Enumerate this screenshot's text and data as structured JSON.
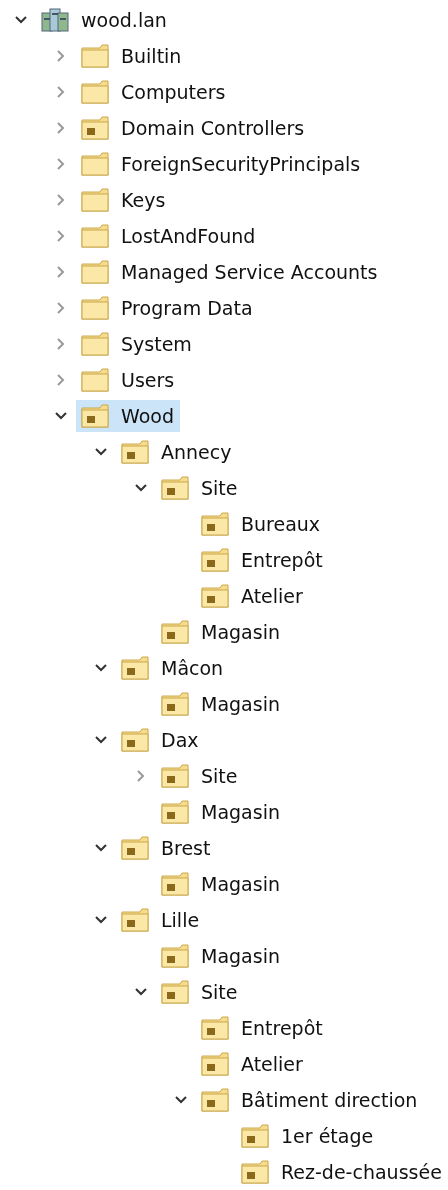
{
  "tree": [
    {
      "label": "wood.lan",
      "kind": "domain",
      "expandable": true,
      "expanded": true,
      "selected": false,
      "children": [
        {
          "label": "Builtin",
          "kind": "container",
          "expandable": true,
          "expanded": false,
          "selected": false
        },
        {
          "label": "Computers",
          "kind": "container",
          "expandable": true,
          "expanded": false,
          "selected": false
        },
        {
          "label": "Domain Controllers",
          "kind": "ou",
          "expandable": true,
          "expanded": false,
          "selected": false
        },
        {
          "label": "ForeignSecurityPrincipals",
          "kind": "container",
          "expandable": true,
          "expanded": false,
          "selected": false
        },
        {
          "label": "Keys",
          "kind": "container",
          "expandable": true,
          "expanded": false,
          "selected": false
        },
        {
          "label": "LostAndFound",
          "kind": "container",
          "expandable": true,
          "expanded": false,
          "selected": false
        },
        {
          "label": "Managed Service Accounts",
          "kind": "container",
          "expandable": true,
          "expanded": false,
          "selected": false
        },
        {
          "label": "Program Data",
          "kind": "container",
          "expandable": true,
          "expanded": false,
          "selected": false
        },
        {
          "label": "System",
          "kind": "container",
          "expandable": true,
          "expanded": false,
          "selected": false
        },
        {
          "label": "Users",
          "kind": "container",
          "expandable": true,
          "expanded": false,
          "selected": false
        },
        {
          "label": "Wood",
          "kind": "ou",
          "expandable": true,
          "expanded": true,
          "selected": true,
          "children": [
            {
              "label": "Annecy",
              "kind": "ou",
              "expandable": true,
              "expanded": true,
              "selected": false,
              "children": [
                {
                  "label": "Site",
                  "kind": "ou",
                  "expandable": true,
                  "expanded": true,
                  "selected": false,
                  "children": [
                    {
                      "label": "Bureaux",
                      "kind": "ou",
                      "expandable": false,
                      "selected": false
                    },
                    {
                      "label": "Entrepôt",
                      "kind": "ou",
                      "expandable": false,
                      "selected": false
                    },
                    {
                      "label": "Atelier",
                      "kind": "ou",
                      "expandable": false,
                      "selected": false
                    }
                  ]
                },
                {
                  "label": "Magasin",
                  "kind": "ou",
                  "expandable": false,
                  "selected": false
                }
              ]
            },
            {
              "label": "Mâcon",
              "kind": "ou",
              "expandable": true,
              "expanded": true,
              "selected": false,
              "children": [
                {
                  "label": "Magasin",
                  "kind": "ou",
                  "expandable": false,
                  "selected": false
                }
              ]
            },
            {
              "label": "Dax",
              "kind": "ou",
              "expandable": true,
              "expanded": true,
              "selected": false,
              "children": [
                {
                  "label": "Site",
                  "kind": "ou",
                  "expandable": true,
                  "expanded": false,
                  "selected": false
                },
                {
                  "label": "Magasin",
                  "kind": "ou",
                  "expandable": false,
                  "selected": false
                }
              ]
            },
            {
              "label": "Brest",
              "kind": "ou",
              "expandable": true,
              "expanded": true,
              "selected": false,
              "children": [
                {
                  "label": "Magasin",
                  "kind": "ou",
                  "expandable": false,
                  "selected": false
                }
              ]
            },
            {
              "label": "Lille",
              "kind": "ou",
              "expandable": true,
              "expanded": true,
              "selected": false,
              "children": [
                {
                  "label": "Magasin",
                  "kind": "ou",
                  "expandable": false,
                  "selected": false
                },
                {
                  "label": "Site",
                  "kind": "ou",
                  "expandable": true,
                  "expanded": true,
                  "selected": false,
                  "children": [
                    {
                      "label": "Entrepôt",
                      "kind": "ou",
                      "expandable": false,
                      "selected": false
                    },
                    {
                      "label": "Atelier",
                      "kind": "ou",
                      "expandable": false,
                      "selected": false
                    },
                    {
                      "label": "Bâtiment direction",
                      "kind": "ou",
                      "expandable": true,
                      "expanded": true,
                      "selected": false,
                      "children": [
                        {
                          "label": "1er étage",
                          "kind": "ou",
                          "expandable": false,
                          "selected": false
                        },
                        {
                          "label": "Rez-de-chaussée",
                          "kind": "ou",
                          "expandable": false,
                          "selected": false
                        }
                      ]
                    }
                  ]
                }
              ]
            }
          ]
        }
      ]
    }
  ]
}
